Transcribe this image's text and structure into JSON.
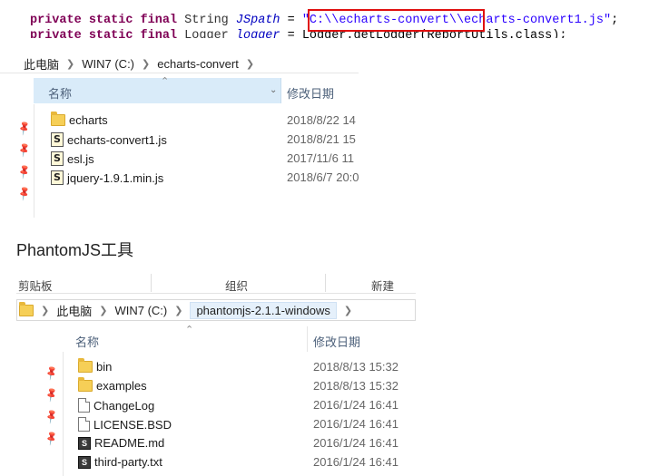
{
  "code": {
    "line1": {
      "kw1": "private",
      "kw2": "static",
      "kw3": "final",
      "type": "String",
      "field": "JSpath",
      "op": "=",
      "string": "\"C:\\\\echarts-convert\\\\echarts-convert1.js\"",
      "end": ";"
    },
    "line2": {
      "kw1": "private",
      "kw2": "static",
      "kw3": "final",
      "type": "Logger",
      "field": "logger",
      "op": "=",
      "rest": "Logger.getLogger(ReportUtils.class);"
    }
  },
  "explorer1": {
    "breadcrumb": [
      "此电脑",
      "WIN7 (C:)",
      "echarts-convert"
    ],
    "columns": {
      "name": "名称",
      "date": "修改日期"
    },
    "files": [
      {
        "icon": "folder-icon",
        "name": "echarts",
        "date": "2018/8/22 14"
      },
      {
        "icon": "js-file-icon",
        "name": "echarts-convert1.js",
        "date": "2018/8/21 15"
      },
      {
        "icon": "js-file-icon",
        "name": "esl.js",
        "date": "2017/11/6 11"
      },
      {
        "icon": "js-file-icon",
        "name": "jquery-1.9.1.min.js",
        "date": "2018/6/7 20:0"
      }
    ]
  },
  "section_title": "PhantomJS工具",
  "explorer2": {
    "ribbon": {
      "clipboard": "剪贴板",
      "organize": "组织",
      "new": "新建"
    },
    "breadcrumb": [
      "此电脑",
      "WIN7 (C:)",
      "phantomjs-2.1.1-windows"
    ],
    "columns": {
      "name": "名称",
      "date": "修改日期"
    },
    "files": [
      {
        "icon": "folder-icon",
        "name": "bin",
        "date": "2018/8/13 15:32"
      },
      {
        "icon": "folder-icon",
        "name": "examples",
        "date": "2018/8/13 15:32"
      },
      {
        "icon": "document-icon",
        "name": "ChangeLog",
        "date": "2016/1/24 16:41"
      },
      {
        "icon": "document-icon",
        "name": "LICENSE.BSD",
        "date": "2016/1/24 16:41"
      },
      {
        "icon": "markdown-file-icon",
        "name": "README.md",
        "date": "2016/1/24 16:41"
      },
      {
        "icon": "text-file-icon",
        "name": "third-party.txt",
        "date": "2016/1/24 16:41"
      }
    ]
  }
}
